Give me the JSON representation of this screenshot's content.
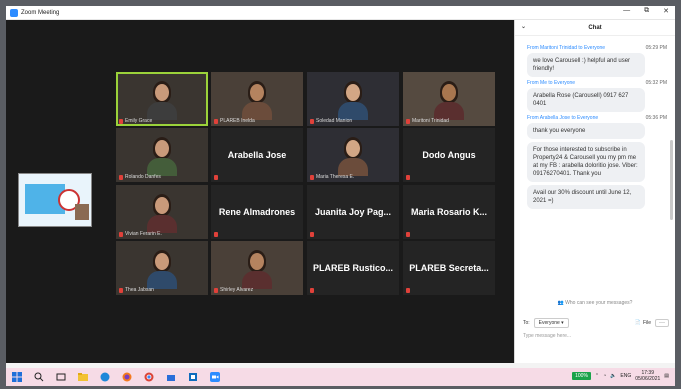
{
  "window": {
    "title": "Zoom Meeting",
    "controls": [
      "—",
      "⧉",
      "✕"
    ]
  },
  "tiles": [
    {
      "label": "Emily Grace",
      "name": "",
      "kind": "person",
      "active": true
    },
    {
      "label": "PLAREB Inelda",
      "name": "",
      "kind": "person"
    },
    {
      "label": "Soledad Manion",
      "name": "",
      "kind": "person"
    },
    {
      "label": "Maritoni Trinidad",
      "name": "",
      "kind": "person"
    },
    {
      "label": "Rolando Danfes",
      "name": "",
      "kind": "person"
    },
    {
      "label": "",
      "name": "Arabella Jose",
      "kind": "name"
    },
    {
      "label": "Maria Theresa E.",
      "name": "",
      "kind": "person"
    },
    {
      "label": "",
      "name": "Dodo Angus",
      "kind": "name"
    },
    {
      "label": "Vivian Ferarin E.",
      "name": "",
      "kind": "person"
    },
    {
      "label": "",
      "name": "Rene Almadrones",
      "kind": "name"
    },
    {
      "label": "",
      "name": "Juanita Joy Pag...",
      "kind": "name"
    },
    {
      "label": "",
      "name": "Maria Rosario K...",
      "kind": "name"
    },
    {
      "label": "Thea Jabsan",
      "name": "",
      "kind": "person"
    },
    {
      "label": "Shirley Alvarez",
      "name": "",
      "kind": "person"
    },
    {
      "label": "",
      "name": "PLAREB Rustico...",
      "kind": "name"
    },
    {
      "label": "",
      "name": "PLAREB Secreta...",
      "kind": "name"
    }
  ],
  "chat": {
    "title": "Chat",
    "messages": [
      {
        "from": "From Maritoni Trinidad to Everyone",
        "time": "05:29 PM",
        "text": "we love Carousell :) helpful and user friendly!"
      },
      {
        "from": "From Me to Everyone",
        "time": "05:32 PM",
        "text": "Arabella Rose (Carousell) 0917 627 0401"
      },
      {
        "from": "From Arabella Jose to Everyone",
        "time": "05:36 PM",
        "text": "thank you everyone"
      },
      {
        "from": "",
        "time": "",
        "text": "For those interested to subscribe in Property24 & Carousell you my pm me at my FB : arabella doloritio jose. Viber: 09176270401. Thank you"
      },
      {
        "from": "",
        "time": "",
        "text": "Avail our 30% discount until June 12, 2021 =)"
      }
    ],
    "who_can_see": "Who can see your messages?",
    "to_label": "To:",
    "to_value": "Everyone ▾",
    "file_label": "File",
    "more_label": "···",
    "input_placeholder": "Type message here..."
  },
  "taskbar": {
    "battery": "100%",
    "lang": "ENG",
    "time": "17:39",
    "date": "05/06/2021",
    "icons": [
      "windows-start",
      "search",
      "task-view",
      "file-explorer",
      "edge",
      "firefox",
      "chrome",
      "store",
      "photos",
      "zoom"
    ]
  },
  "colors": {
    "active_speaker": "#9bd23a",
    "mic_off": "#e0413a",
    "link_blue": "#2d8cff",
    "taskbar": "#f6dbe6"
  }
}
